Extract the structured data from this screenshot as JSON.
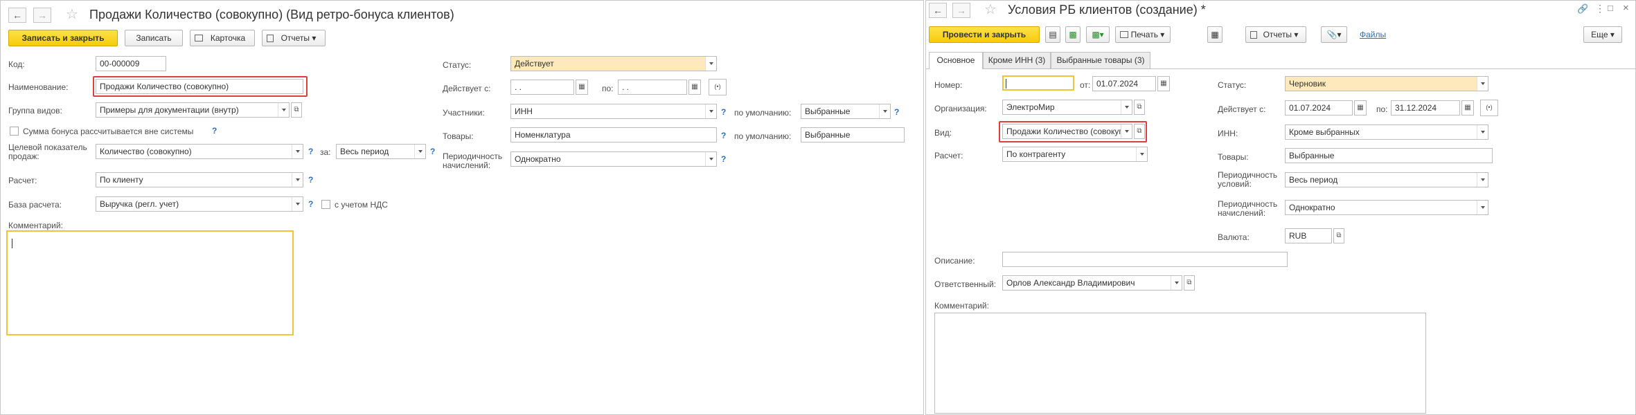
{
  "left": {
    "title": "Продажи Количество (совокупно) (Вид ретро-бонуса клиентов)",
    "toolbar": {
      "save_close": "Записать и закрыть",
      "save": "Записать",
      "card": "Карточка",
      "reports": "Отчеты"
    },
    "fields": {
      "code_label": "Код:",
      "code_value": "00-000009",
      "name_label": "Наименование:",
      "name_value": "Продажи Количество (совокупно)",
      "group_label": "Группа видов:",
      "group_value": "Примеры для документации (внутр)",
      "outside_label": "Сумма бонуса рассчитывается вне системы",
      "target_label": "Целевой показатель продаж:",
      "target_value": "Количество (совокупно)",
      "for_label": "за:",
      "for_value": "Весь период",
      "calc_label": "Расчет:",
      "calc_value": "По клиенту",
      "base_label": "База расчета:",
      "base_value": "Выручка (регл. учет)",
      "vat_label": "с учетом НДС",
      "comment_label": "Комментарий:",
      "status_label": "Статус:",
      "status_value": "Действует",
      "valid_label": "Действует с:",
      "valid_from": " .  .",
      "to_label": "по:",
      "valid_to": " .  .",
      "participants_label": "Участники:",
      "participants_value": "ИНН",
      "default_label": "по умолчанию:",
      "participants_default": "Выбранные",
      "goods_label": "Товары:",
      "goods_value": "Номенклатура",
      "goods_default": "Выбранные",
      "period_label": "Периодичность начислений:",
      "period_value": "Однократно"
    }
  },
  "right": {
    "title": "Условия РБ клиентов (создание) *",
    "toolbar": {
      "post_close": "Провести и закрыть",
      "print": "Печать",
      "reports": "Отчеты",
      "files": "Файлы",
      "more": "Еще"
    },
    "tabs": [
      "Основное",
      "Кроме ИНН (3)",
      "Выбранные товары (3)"
    ],
    "fields": {
      "number_label": "Номер:",
      "number_value": "",
      "from_label": "от:",
      "date_value": "01.07.2024",
      "org_label": "Организация:",
      "org_value": "ЭлектроМир",
      "kind_label": "Вид:",
      "kind_value": "Продажи Количество (совокупно)",
      "calc_label": "Расчет:",
      "calc_value": "По контрагенту",
      "status_label": "Статус:",
      "status_value": "Черновик",
      "valid_label": "Действует с:",
      "valid_from": "01.07.2024",
      "to_label": "по:",
      "valid_to": "31.12.2024",
      "inn_label": "ИНН:",
      "inn_value": "Кроме выбранных",
      "goods_label": "Товары:",
      "goods_value": "Выбранные",
      "period_cond_label": "Периодичность условий:",
      "period_cond_value": "Весь период",
      "period_acc_label": "Периодичность начислений:",
      "period_acc_value": "Однократно",
      "currency_label": "Валюта:",
      "currency_value": "RUB",
      "desc_label": "Описание:",
      "resp_label": "Ответственный:",
      "resp_value": "Орлов Александр Владимирович",
      "comment_label": "Комментарий:"
    }
  }
}
